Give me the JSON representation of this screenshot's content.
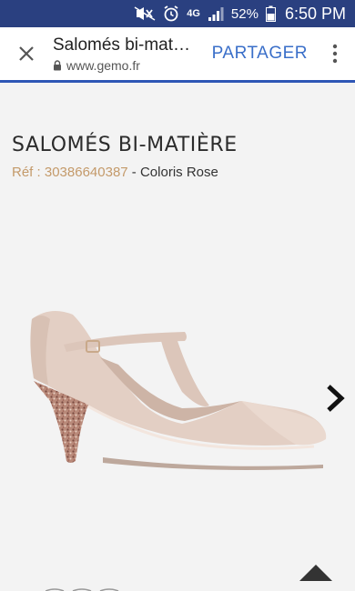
{
  "status_bar": {
    "network": "4G",
    "battery": "52%",
    "time": "6:50 PM"
  },
  "tab": {
    "title": "Salomés bi-mat…",
    "url": "www.gemo.fr",
    "share_label": "PARTAGER"
  },
  "product": {
    "name": "SALOMÉS BI-MATIÈRE",
    "ref_label": "Réf :",
    "ref_number": "30386640387",
    "separator": "-",
    "color_text": "Coloris Rose"
  },
  "colors": {
    "status_bar": "#2a4080",
    "accent": "#3a6fc9",
    "ref_text": "#c49a6a",
    "shoe_suede": "#e3cfc4",
    "shoe_glitter": "#b07868"
  }
}
